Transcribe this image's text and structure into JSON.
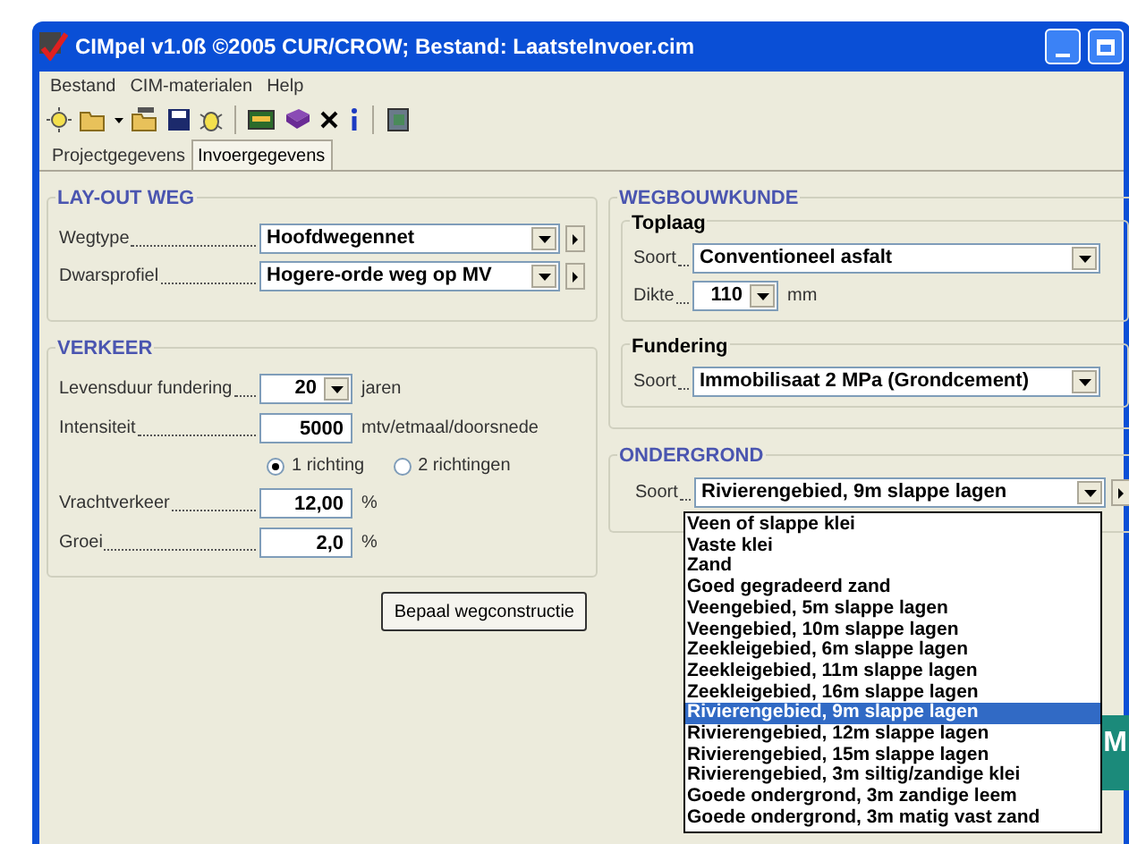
{
  "window": {
    "title": "CIMpel v1.0ß ©2005 CUR/CROW; Bestand: LaatsteInvoer.cim"
  },
  "menu": [
    "Bestand",
    "CIM-materialen",
    "Help"
  ],
  "tabs": [
    {
      "label": "Projectgegevens",
      "selected": false
    },
    {
      "label": "Invoergegevens",
      "selected": true
    }
  ],
  "layout_weg": {
    "title": "LAY-OUT WEG",
    "rows": [
      {
        "label": "Wegtype",
        "value": "Hoofdwegennet"
      },
      {
        "label": "Dwarsprofiel",
        "value": "Hogere-orde weg op MV"
      }
    ]
  },
  "verkeer": {
    "title": "VERKEER",
    "levensduur": {
      "label": "Levensduur fundering",
      "value": "20",
      "unit": "jaren"
    },
    "intensiteit": {
      "label": "Intensiteit",
      "value": "5000",
      "unit": "mtv/etmaal/doorsnede"
    },
    "richting": [
      {
        "label": "1 richting",
        "selected": true
      },
      {
        "label": "2 richtingen",
        "selected": false
      }
    ],
    "fields": [
      {
        "label": "Vrachtverkeer",
        "value": "12,00",
        "unit": "%"
      },
      {
        "label": "Groei",
        "value": "2,0",
        "unit": "%"
      }
    ]
  },
  "button": "Bepaal wegconstructie",
  "wegbouwkunde": {
    "title": "WEGBOUWKUNDE",
    "toplaag": {
      "title": "Toplaag",
      "soort_label": "Soort",
      "soort": "Conventioneel asfalt",
      "dikte_label": "Dikte",
      "dikte": "110",
      "unit": "mm"
    },
    "fundering": {
      "title": "Fundering",
      "soort_label": "Soort",
      "soort": "Immobilisaat 2 MPa (Grondcement)"
    }
  },
  "ondergrond": {
    "title": "ONDERGROND",
    "soort_label": "Soort",
    "soort": "Rivierengebied, 9m slappe lagen",
    "options": [
      {
        "label": "Veen of slappe klei",
        "selected": false
      },
      {
        "label": "Vaste klei",
        "selected": false
      },
      {
        "label": "Zand",
        "selected": false
      },
      {
        "label": "Goed gegradeerd zand",
        "selected": false
      },
      {
        "label": "Veengebied, 5m slappe lagen",
        "selected": false
      },
      {
        "label": "Veengebied, 10m slappe lagen",
        "selected": false
      },
      {
        "label": "Zeekleigebied, 6m slappe lagen",
        "selected": false
      },
      {
        "label": "Zeekleigebied, 11m slappe lagen",
        "selected": false
      },
      {
        "label": "Zeekleigebied, 16m slappe lagen",
        "selected": false
      },
      {
        "label": "Rivierengebied, 9m slappe lagen",
        "selected": true
      },
      {
        "label": "Rivierengebied, 12m slappe lagen",
        "selected": false
      },
      {
        "label": "Rivierengebied, 15m slappe lagen",
        "selected": false
      },
      {
        "label": "Rivierengebied, 3m siltig/zandige klei",
        "selected": false
      },
      {
        "label": "Goede ondergrond, 3m zandige leem",
        "selected": false
      },
      {
        "label": "Goede ondergrond, 3m matig vast zand",
        "selected": false
      }
    ]
  },
  "logo_fragment": "M"
}
